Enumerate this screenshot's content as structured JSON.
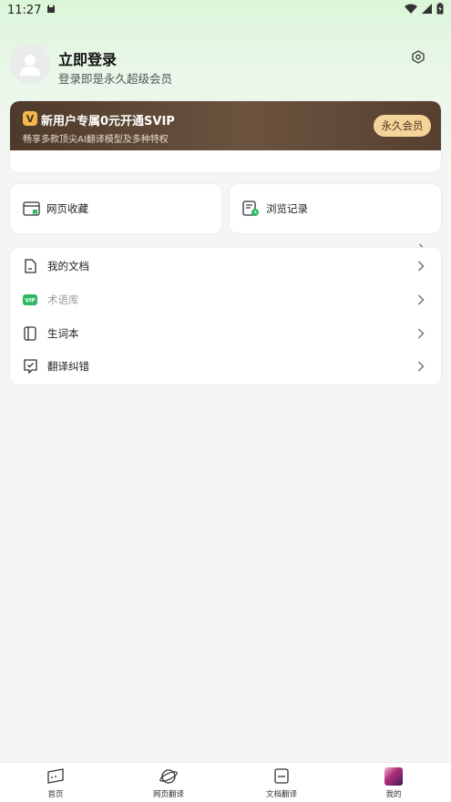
{
  "status_bar": {
    "time": "11:27"
  },
  "profile": {
    "title": "立即登录",
    "subtitle": "登录即是永久超级会员"
  },
  "vip": {
    "badge": "V",
    "title": "新用户专属0元开通SVIP",
    "description": "畅享多款顶尖AI翻译模型及多种特权",
    "button": "永久会员",
    "colors": {
      "banner": "#5a4331",
      "button_bg": "#f5d49a",
      "badge_bg": "#f2b84b"
    }
  },
  "quick": {
    "favorites": "网页收藏",
    "history": "浏览记录"
  },
  "menu": {
    "items": [
      {
        "label": "我的文档",
        "icon": "document-icon",
        "muted": false
      },
      {
        "label": "术语库",
        "icon": "vip-icon",
        "muted": true,
        "badge": "VIP"
      },
      {
        "label": "生词本",
        "icon": "notebook-icon",
        "muted": false
      },
      {
        "label": "翻译纠错",
        "icon": "feedback-icon",
        "muted": false
      }
    ]
  },
  "tabbar": {
    "items": [
      {
        "label": "首页",
        "icon": "home-icon"
      },
      {
        "label": "网页翻译",
        "icon": "planet-icon"
      },
      {
        "label": "文档翻译",
        "icon": "document-translate-icon"
      },
      {
        "label": "我的",
        "icon": "profile-picture-icon"
      }
    ]
  },
  "accent": "#2fb864"
}
